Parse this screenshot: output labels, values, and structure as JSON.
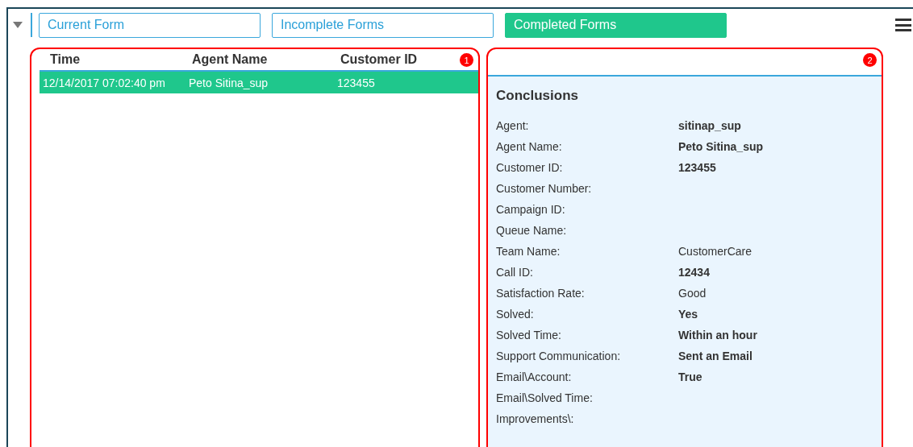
{
  "tabs": [
    {
      "label": "Current Form",
      "selected": false
    },
    {
      "label": "Incomplete Forms",
      "selected": false
    },
    {
      "label": "Completed Forms",
      "selected": true
    }
  ],
  "table": {
    "columns": [
      "Time",
      "Agent Name",
      "Customer ID"
    ],
    "callout": "1",
    "rows": [
      {
        "cells": [
          "12/14/2017 07:02:40 pm",
          "Peto Sitina_sup",
          "123455"
        ],
        "selected": true
      }
    ]
  },
  "details": {
    "callout": "2",
    "title": "Conclusions",
    "fields": [
      {
        "label": "Agent:",
        "value": "sitinap_sup",
        "bold": true
      },
      {
        "label": "Agent Name:",
        "value": "Peto Sitina_sup",
        "bold": true
      },
      {
        "label": "Customer ID:",
        "value": "123455",
        "bold": true
      },
      {
        "label": "Customer Number:"
      },
      {
        "label": "Campaign ID:"
      },
      {
        "label": "Queue Name:"
      },
      {
        "label": "Team Name:",
        "value": "CustomerCare",
        "bold": false
      },
      {
        "label": "Call ID:",
        "value": "12434",
        "bold": true
      },
      {
        "label": "Satisfaction Rate:",
        "value": "Good",
        "bold": false
      },
      {
        "label": "Solved:",
        "value": "Yes",
        "bold": true
      },
      {
        "label": "Solved Time:",
        "value": "Within an hour",
        "bold": true
      },
      {
        "label": "Support Communication:",
        "value": "Sent an Email",
        "bold": true
      },
      {
        "label": "Email\\Account:",
        "value": "True",
        "bold": true
      },
      {
        "label": "Email\\Solved Time:"
      },
      {
        "label": "Improvements\\:"
      }
    ]
  }
}
